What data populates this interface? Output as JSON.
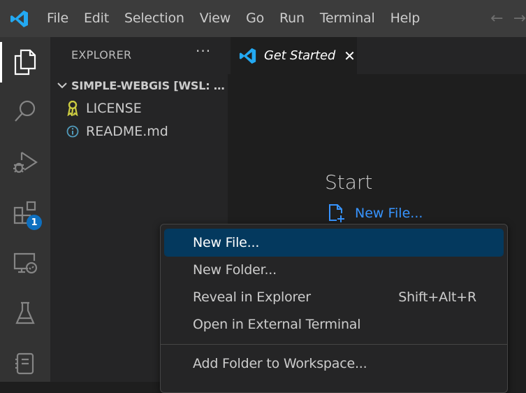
{
  "menubar": {
    "items": [
      "File",
      "Edit",
      "Selection",
      "View",
      "Go",
      "Run",
      "Terminal",
      "Help"
    ]
  },
  "activity_bar": {
    "items": [
      "explorer-icon",
      "search-icon",
      "run-debug-icon",
      "extensions-icon",
      "remote-explorer-icon",
      "testing-icon",
      "notebook-icon"
    ],
    "extensions_badge": "1"
  },
  "sidebar": {
    "title": "EXPLORER",
    "more_actions": "···",
    "folder_name": "SIMPLE-WEBGIS [WSL: UB...",
    "files": [
      {
        "name": "LICENSE",
        "icon": "license-icon"
      },
      {
        "name": "README.md",
        "icon": "info-icon"
      }
    ]
  },
  "tabs": [
    {
      "label": "Get Started",
      "active": true
    }
  ],
  "welcome": {
    "start_heading": "Start",
    "new_file_link": "New File..."
  },
  "context_menu": {
    "items": [
      {
        "label": "New File...",
        "shortcut": "",
        "selected": true
      },
      {
        "label": "New Folder...",
        "shortcut": ""
      },
      {
        "label": "Reveal in Explorer",
        "shortcut": "Shift+Alt+R"
      },
      {
        "label": "Open in External Terminal",
        "shortcut": ""
      },
      {
        "label": "Add Folder to Workspace...",
        "shortcut": ""
      }
    ]
  },
  "colors": {
    "accent": "#0e70c0",
    "link": "#3794ff",
    "selection": "#04395e",
    "license_icon": "#cbcb41",
    "info_icon": "#519aba"
  }
}
